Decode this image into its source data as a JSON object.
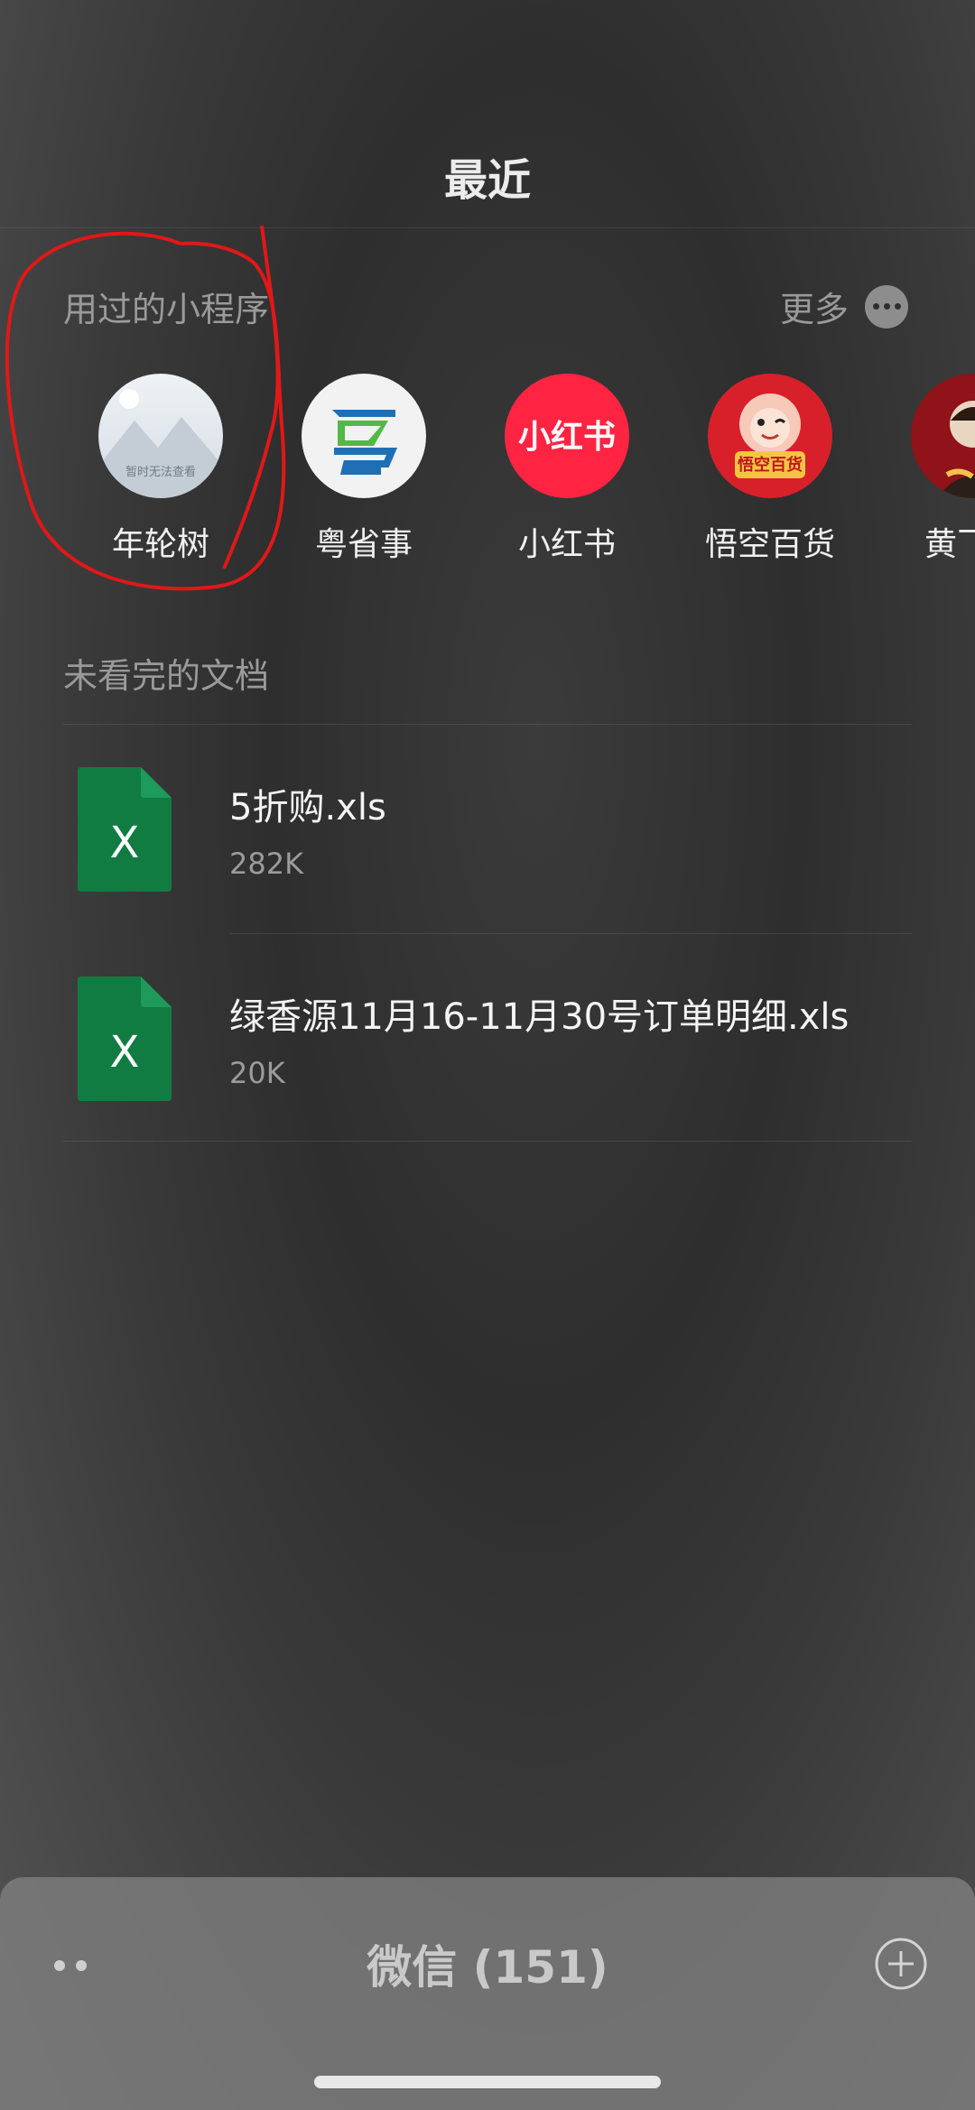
{
  "header": {
    "title": "最近"
  },
  "mini_programs": {
    "heading": "用过的小程序",
    "more_label": "更多",
    "items": [
      {
        "label": "年轮树",
        "icon": "placeholder-image-icon",
        "placeholder_text": "暂时无法查看"
      },
      {
        "label": "粤省事",
        "icon": "yueshengshi-logo-icon"
      },
      {
        "label": "小红书",
        "icon": "xiaohongshu-logo-icon",
        "logo_text": "小红书"
      },
      {
        "label": "悟空百货",
        "icon": "wukong-monkey-logo-icon",
        "logo_text": "悟空百货"
      },
      {
        "label": "黄飞鸿",
        "icon": "portrait-avatar-icon"
      }
    ]
  },
  "documents": {
    "heading": "未看完的文档",
    "items": [
      {
        "name": "5折购.xls",
        "size": "282K",
        "icon": "excel-file-icon",
        "icon_letter": "X"
      },
      {
        "name": "绿香源11月16-11月30号订单明细.xls",
        "size": "20K",
        "icon": "excel-file-icon",
        "icon_letter": "X"
      }
    ]
  },
  "bottom_bar": {
    "title": "微信 (151)"
  },
  "colors": {
    "excel_green": "#107c41",
    "xiaohongshu_red": "#ff2442",
    "annotation_red": "#e01818"
  }
}
